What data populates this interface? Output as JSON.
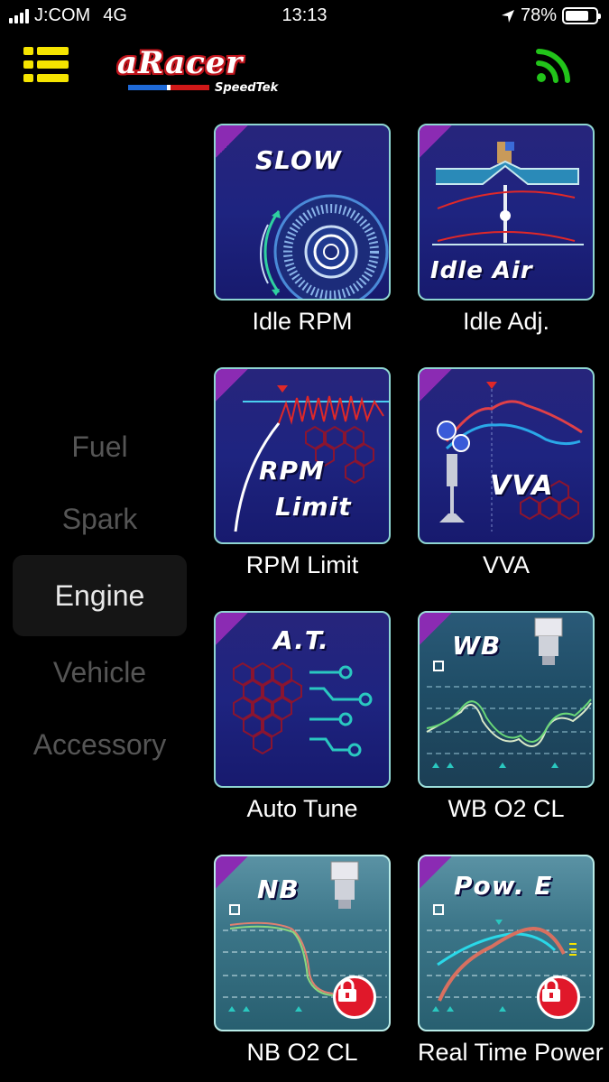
{
  "status_bar": {
    "carrier": "J:COM",
    "network": "4G",
    "time": "13:13",
    "battery": "78%",
    "battery_level": 0.78
  },
  "header": {
    "logo_main": "aRacer",
    "logo_sub": "SpeedTek",
    "menu_icon": "list-menu-icon",
    "connection_icon": "wireless-signal-icon",
    "accent_color": "#f5e400",
    "connection_color": "#22c41a"
  },
  "sidebar": {
    "items": [
      {
        "label": "Fuel",
        "active": false
      },
      {
        "label": "Spark",
        "active": false
      },
      {
        "label": "Engine",
        "active": true
      },
      {
        "label": "Vehicle",
        "active": false
      },
      {
        "label": "Accessory",
        "active": false
      }
    ]
  },
  "tiles": [
    {
      "label": "Idle RPM",
      "art_text": "SLOW",
      "locked": false
    },
    {
      "label": "Idle Adj.",
      "art_text": "Idle Air",
      "locked": false
    },
    {
      "label": "RPM Limit",
      "art_text": "RPM Limit",
      "art_line1": "RPM",
      "art_line2": "Limit",
      "locked": false
    },
    {
      "label": "VVA",
      "art_text": "VVA",
      "locked": false
    },
    {
      "label": "Auto Tune",
      "art_text": "A.T.",
      "locked": false
    },
    {
      "label": "WB O2 CL",
      "art_text": "WB",
      "locked": false
    },
    {
      "label": "NB O2 CL",
      "art_text": "NB",
      "locked": true
    },
    {
      "label": "Real Time Power",
      "art_text": "Pow. E",
      "locked": true
    }
  ]
}
